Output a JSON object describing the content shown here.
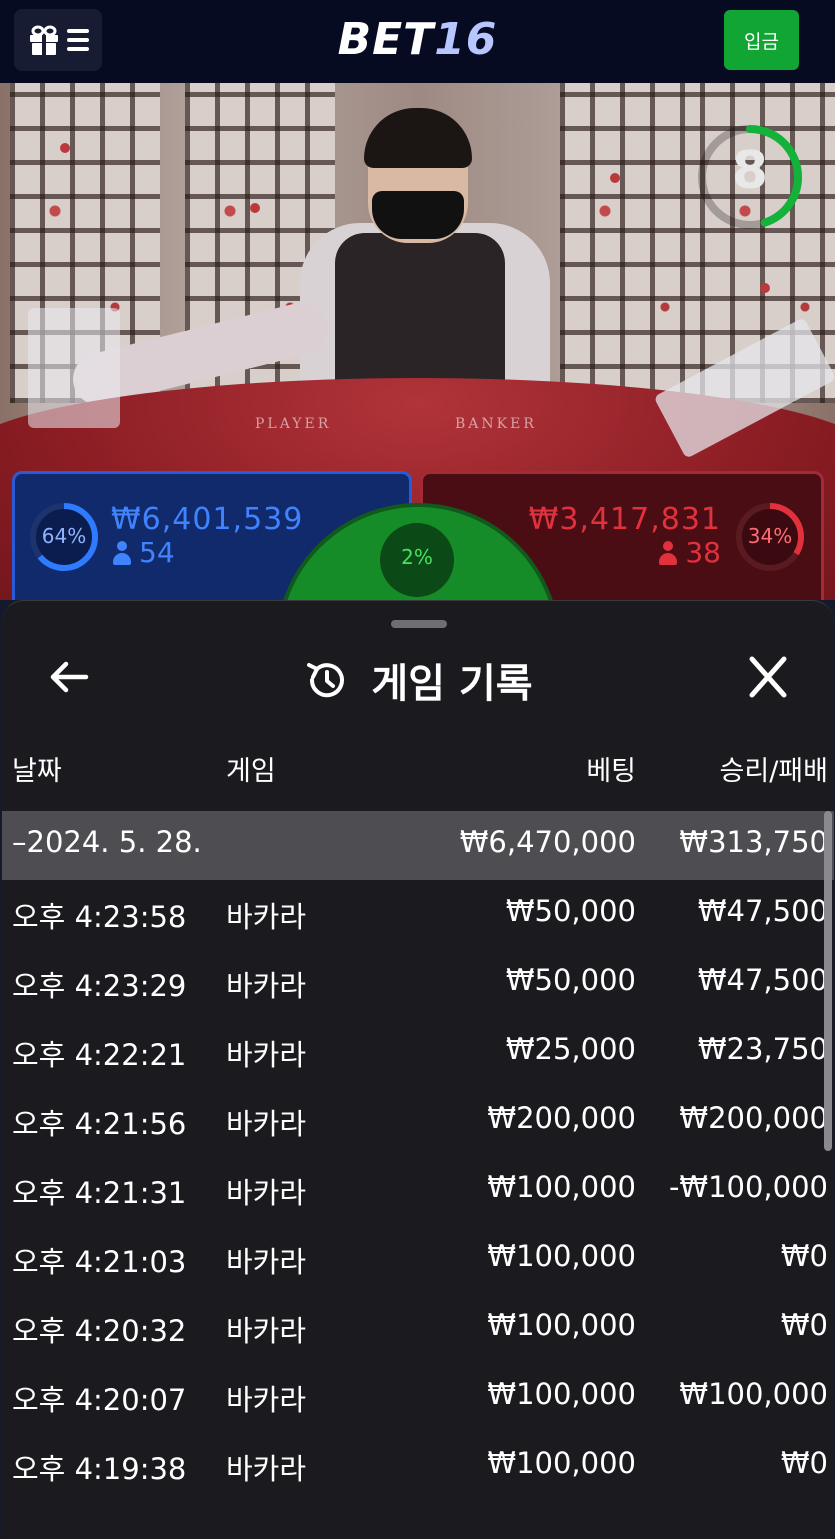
{
  "header": {
    "logo_main": "BET",
    "logo_accent": "16",
    "deposit_label": "입금"
  },
  "scene": {
    "countdown": "8",
    "table_label_player": "PLAYER",
    "table_label_banker": "BANKER",
    "player": {
      "percent": "64%",
      "amount": "₩6,401,539",
      "count": "54",
      "fraction": 0.64
    },
    "banker": {
      "percent": "34%",
      "amount": "₩3,417,831",
      "count": "38",
      "fraction": 0.34
    },
    "tie": {
      "percent": "2%"
    }
  },
  "modal": {
    "title": "게임 기록",
    "columns": {
      "date": "날짜",
      "game": "게임",
      "bet": "베팅",
      "result": "승리/패배"
    },
    "summary": {
      "date": "–2024. 5. 28.",
      "bet": "₩6,470,000",
      "result": "₩313,750"
    },
    "rows": [
      {
        "time": "오후 4:23:58",
        "game": "바카라",
        "bet": "₩50,000",
        "result": "₩47,500"
      },
      {
        "time": "오후 4:23:29",
        "game": "바카라",
        "bet": "₩50,000",
        "result": "₩47,500"
      },
      {
        "time": "오후 4:22:21",
        "game": "바카라",
        "bet": "₩25,000",
        "result": "₩23,750"
      },
      {
        "time": "오후 4:21:56",
        "game": "바카라",
        "bet": "₩200,000",
        "result": "₩200,000"
      },
      {
        "time": "오후 4:21:31",
        "game": "바카라",
        "bet": "₩100,000",
        "result": "-₩100,000"
      },
      {
        "time": "오후 4:21:03",
        "game": "바카라",
        "bet": "₩100,000",
        "result": "₩0"
      },
      {
        "time": "오후 4:20:32",
        "game": "바카라",
        "bet": "₩100,000",
        "result": "₩0"
      },
      {
        "time": "오후 4:20:07",
        "game": "바카라",
        "bet": "₩100,000",
        "result": "₩100,000"
      },
      {
        "time": "오후 4:19:38",
        "game": "바카라",
        "bet": "₩100,000",
        "result": "₩0"
      }
    ]
  },
  "colors": {
    "deposit": "#11a534",
    "player": "#2f7bff",
    "banker": "#e0313d",
    "tie": "#48e05e"
  }
}
